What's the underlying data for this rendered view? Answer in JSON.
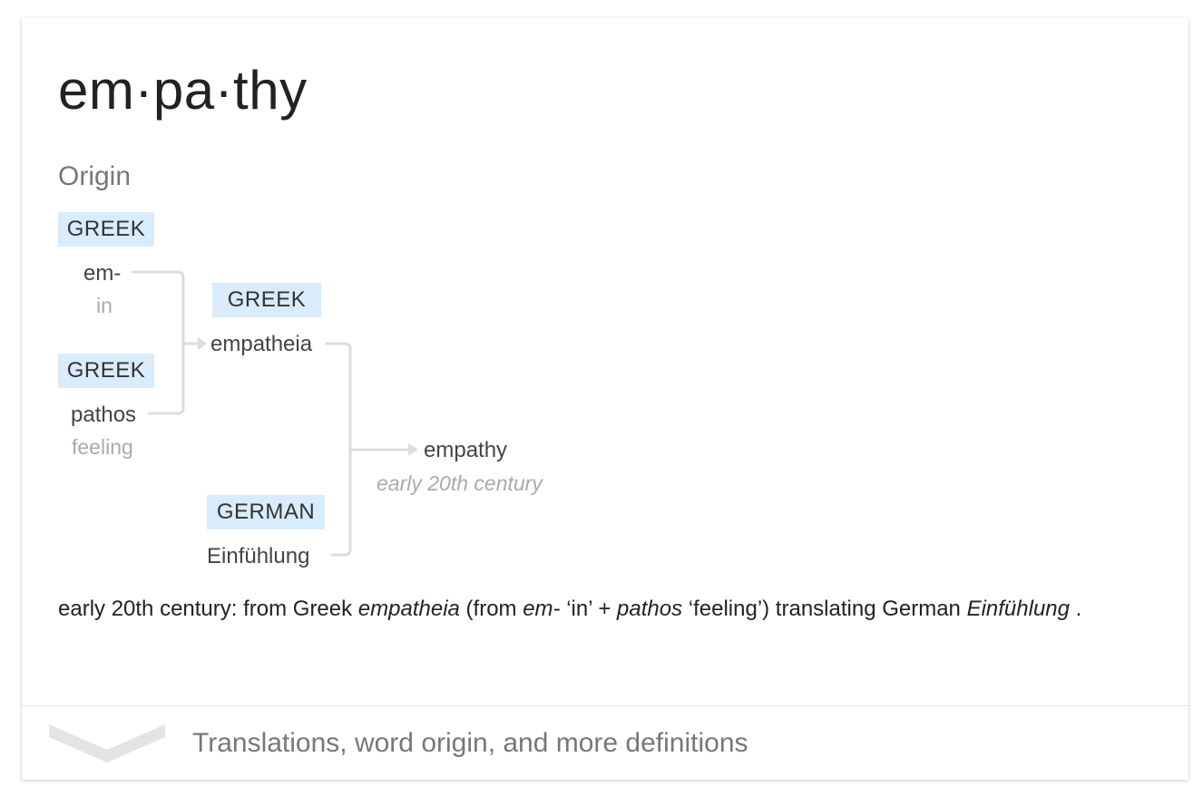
{
  "headword": "em·pa·thy",
  "origin_title": "Origin",
  "tree": {
    "greek_em": {
      "lang": "GREEK",
      "word": "em-",
      "gloss": "in"
    },
    "greek_pathos": {
      "lang": "GREEK",
      "word": "pathos",
      "gloss": "feeling"
    },
    "greek_empatheia": {
      "lang": "GREEK",
      "word": "empatheia"
    },
    "german": {
      "lang": "GERMAN",
      "word": "Einfühlung"
    },
    "result": {
      "word": "empathy",
      "date": "early 20th century"
    }
  },
  "etymology": {
    "p1": "early 20th century: from Greek ",
    "w1": "empatheia",
    "p2": " (from ",
    "w2": "em-",
    "p3": " ‘in’ + ",
    "w3": "pathos",
    "p4": " ‘feeling’) translating German ",
    "w4": "Einfühlung",
    "p5": " ."
  },
  "footer": {
    "more_label": "Translations, word origin, and more definitions",
    "icon": "chevron-down-icon"
  },
  "colors": {
    "chip_bg": "#d9ecfb",
    "connector": "#dddddd",
    "muted_text": "#777777"
  }
}
